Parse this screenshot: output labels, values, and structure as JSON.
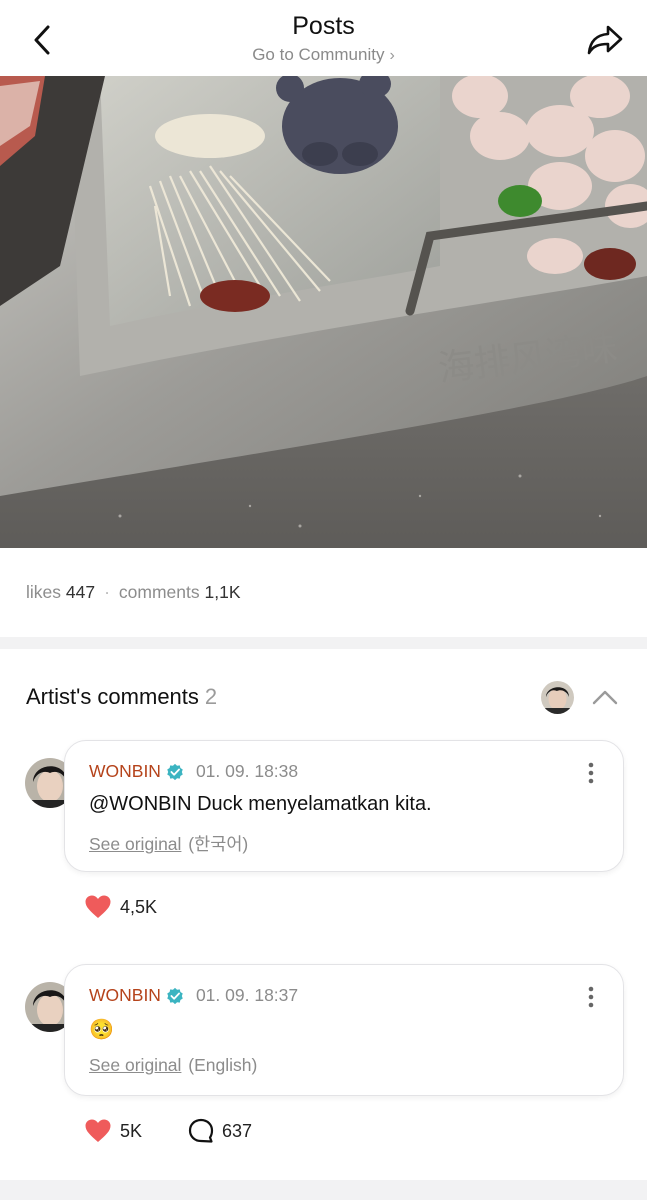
{
  "header": {
    "title": "Posts",
    "subtitle": "Go to Community",
    "subtitle_chevron": "›",
    "back_icon": "chevron-left-icon",
    "share_icon": "share-arrow-icon"
  },
  "photo": {
    "overlay_text": "海排风湾味"
  },
  "stats": {
    "likes_label": "likes",
    "likes_value": "447",
    "separator": "·",
    "comments_label": "comments",
    "comments_value": "1,1K"
  },
  "artist_comments": {
    "title": "Artist's comments",
    "count": "2",
    "collapse_icon": "chevron-up-icon",
    "items": [
      {
        "author": "WONBIN",
        "time": "01. 09. 18:38",
        "text": "@WONBIN Duck menyelamatkan kita.",
        "see_original": "See original",
        "language": "(한국어)",
        "likes": "4,5K"
      },
      {
        "author": "WONBIN",
        "time": "01. 09. 18:37",
        "text": "🥺",
        "see_original": "See original",
        "language": "(English)",
        "likes": "5K",
        "replies": "637"
      }
    ]
  },
  "colors": {
    "author": "#b5431b",
    "verified": "#3bb4c1",
    "heart": "#ef5b5b",
    "muted": "#8c8c8c"
  }
}
